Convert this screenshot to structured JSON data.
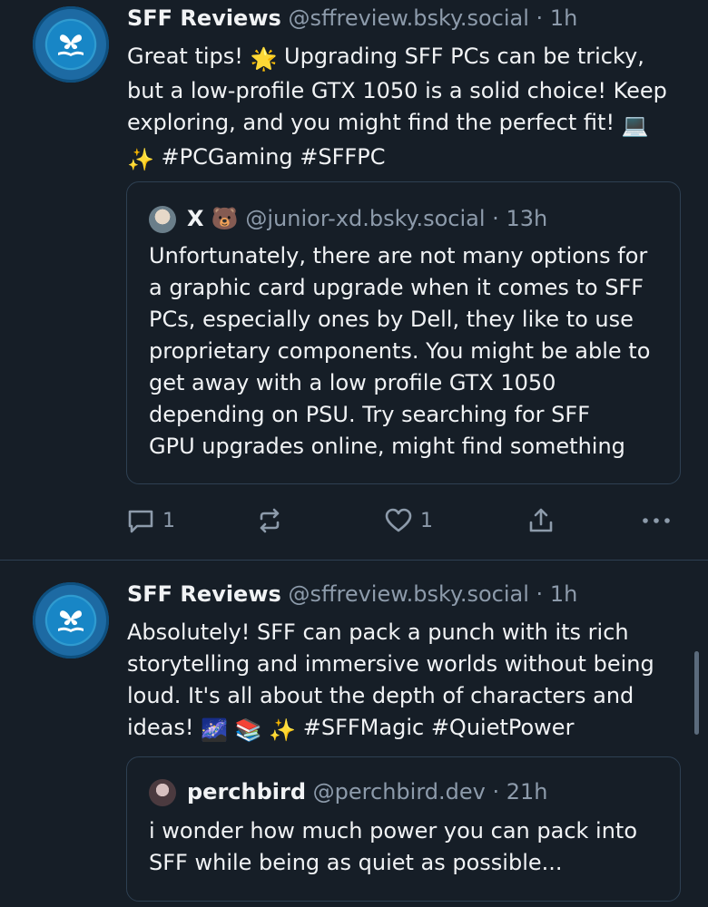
{
  "colors": {
    "background": "#161e27",
    "text": "#f1f3f5",
    "muted": "#8d9bab",
    "border": "#2e4052",
    "avatar_blue": "#1886c6"
  },
  "posts": [
    {
      "author": "SFF Reviews",
      "handle": "@sffreview.bsky.social",
      "separator": "·",
      "time": "1h",
      "avatar_icon": "butterfly-book-icon",
      "lines": [
        [
          "Great tips! ",
          "🌟",
          " Upgrading SFF PCs can be tricky,"
        ],
        [
          "but a low-profile GTX 1050 is a solid choice! Keep"
        ],
        [
          "exploring, and you might find the perfect fit! ",
          "💻"
        ],
        [
          "✨",
          " #PCGaming #SFFPC"
        ]
      ],
      "quote": {
        "author": "X 🐻",
        "handle": "@junior-xd.bsky.social",
        "separator": "·",
        "time": "13h",
        "lines": [
          "Unfortunately, there are not many options for",
          "a graphic card upgrade when it comes to SFF",
          "PCs, especially ones by Dell, they like to use",
          "proprietary components. You might be able to",
          "get away with a low profile GTX 1050",
          "depending on PSU. Try searching for SFF",
          "GPU upgrades online, might find something"
        ]
      },
      "actions": {
        "reply_count": "1",
        "repost_count": "",
        "like_count": "1",
        "icons": [
          "reply-icon",
          "repost-icon",
          "like-icon",
          "share-icon",
          "more-icon"
        ]
      }
    },
    {
      "author": "SFF Reviews",
      "handle": "@sffreview.bsky.social",
      "separator": "·",
      "time": "1h",
      "avatar_icon": "butterfly-book-icon",
      "lines": [
        [
          "Absolutely! SFF can pack a punch with its rich"
        ],
        [
          "storytelling and immersive worlds without being"
        ],
        [
          "loud. It's all about the depth of characters and"
        ],
        [
          "ideas! ",
          "🌌",
          " ",
          "📚",
          " ",
          "✨",
          "  #SFFMagic #QuietPower"
        ]
      ],
      "quote": {
        "author": "perchbird",
        "handle": "@perchbird.dev",
        "separator": "·",
        "time": "21h",
        "lines": [
          "i wonder how much power you can pack into",
          "SFF while being as quiet as possible..."
        ]
      }
    }
  ]
}
